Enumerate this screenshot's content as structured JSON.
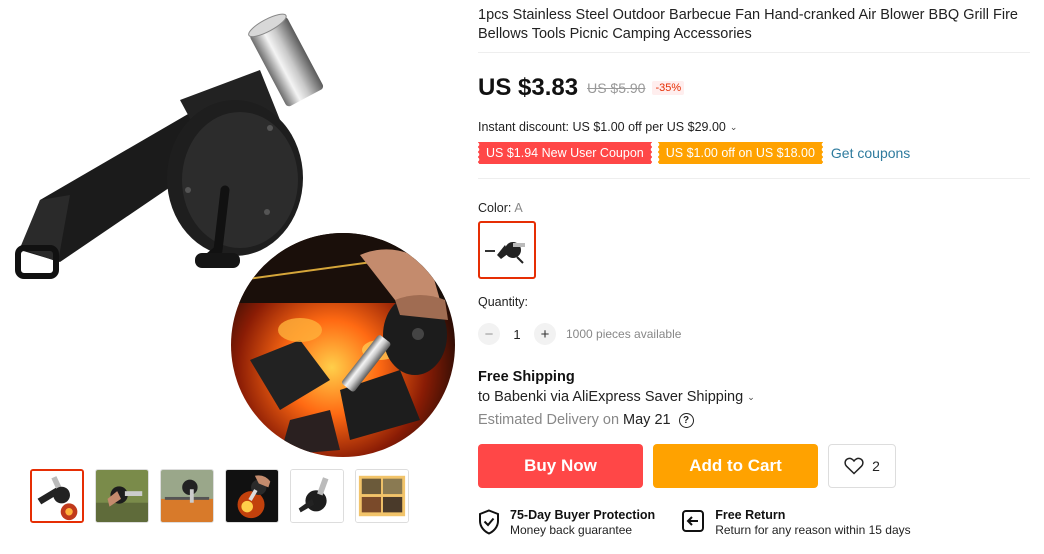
{
  "product": {
    "title": "1pcs Stainless Steel Outdoor Barbecue Fan Hand-cranked Air Blower BBQ Grill Fire Bellows Tools Picnic Camping Accessories",
    "price": "US $3.83",
    "original_price": "US $5.90",
    "discount": "-35%",
    "instant_discount": "Instant discount: US $1.00 off per US $29.00",
    "coupons": [
      "US $1.94 New User Coupon",
      "US $1.00 off on US $18.00"
    ],
    "get_coupons": "Get coupons",
    "color_label": "Color:",
    "color_value": "A",
    "quantity_label": "Quantity:",
    "quantity": "1",
    "available": "1000 pieces available"
  },
  "shipping": {
    "title": "Free Shipping",
    "to": "to Babenki via AliExpress Saver Shipping",
    "delivery_label": "Estimated Delivery on",
    "delivery_date": "May 21"
  },
  "actions": {
    "buy_now": "Buy Now",
    "add_to_cart": "Add to Cart",
    "wishlist_count": "2"
  },
  "guarantees": [
    {
      "title": "75-Day Buyer Protection",
      "subtitle": "Money back guarantee",
      "icon": "shield-check-icon"
    },
    {
      "title": "Free Return",
      "subtitle": "Return for any reason within 15 days",
      "icon": "return-box-icon"
    }
  ],
  "colors": {
    "accent": "#ff4747",
    "cart": "#ffa200",
    "link": "#2e7b9e",
    "selected_border": "#e62e04"
  }
}
